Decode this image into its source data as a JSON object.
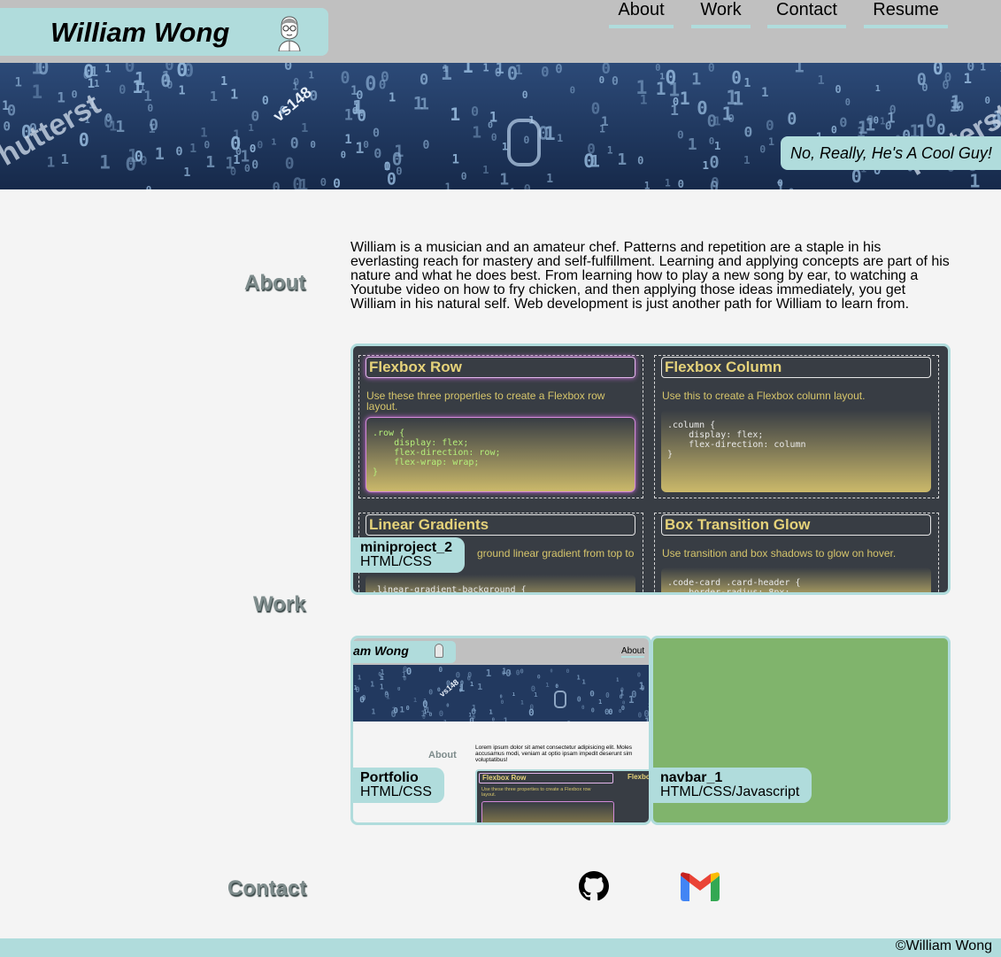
{
  "header": {
    "brand": "William Wong",
    "avatar_icon": "cartoon-avatar-icon",
    "nav": [
      "About",
      "Work",
      "Contact",
      "Resume"
    ]
  },
  "banner": {
    "tagline": "No, Really, He's A Cool Guy!"
  },
  "about": {
    "heading": "About",
    "text": "William is a musician and an amateur chef. Patterns and repetition are a staple in his everlasting reach for mastery and self-fulfillment. Learning and applying concepts are part of his nature and what he does best. From learning how to play a new song by ear, to watching a Youtube video on how to fry chicken, and then applying those ideas immediately, you get William in his natural self. Web development is just another path for William to learn from."
  },
  "work": {
    "heading": "Work",
    "projects": [
      {
        "title": "miniproject_2",
        "tech": "HTML/CSS",
        "preview": {
          "cards": [
            {
              "title": "Flexbox Row",
              "desc": "Use these three properties to create a Flexbox row layout.",
              "code": ".row {\n    display: flex;\n    flex-direction: row;\n    flex-wrap: wrap;\n}"
            },
            {
              "title": "Flexbox Column",
              "desc": "Use this to create a Flexbox column layout.",
              "code": ".column {\n    display: flex;\n    flex-direction: column\n}"
            },
            {
              "title": "Linear Gradients",
              "desc": "ground linear gradient from top to",
              "code": ".linear-gradient-background {"
            },
            {
              "title": "Box Transition Glow",
              "desc": "Use transition and box shadows to glow on hover.",
              "code": ".code-card .card-header {\n    border-radius: 8px;"
            }
          ]
        }
      },
      {
        "title": "Portfolio",
        "tech": "HTML/CSS",
        "preview": {
          "brand": "am Wong",
          "nav": "About",
          "about_heading": "About",
          "about_text": "Lorem ipsum dolor sit amet consectetur adipisicing elit. Moles accusamus modi, veniam at optio ipsam impedit deserunt sim voluptatibus!",
          "card1": "Flexbox Row",
          "card1_desc": "Use these three properties to create a Flexbox row layout.",
          "card2": "Flexbo"
        }
      },
      {
        "title": "navbar_1",
        "tech": "HTML/CSS/Javascript",
        "color": "#80b46c"
      }
    ]
  },
  "contact": {
    "heading": "Contact",
    "icons": [
      "github-icon",
      "gmail-icon"
    ]
  },
  "footer": {
    "text": "©William Wong"
  },
  "colors": {
    "accent": "#b0dcdc",
    "header_bg": "#c0c0c0",
    "page_bg": "#f4f4f4",
    "heading": "#7d8b8b"
  }
}
